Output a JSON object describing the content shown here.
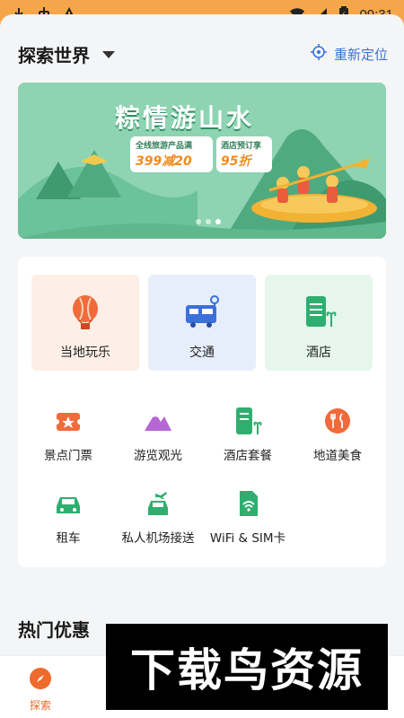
{
  "status_bar": {
    "time": "09:31",
    "icons": [
      "download-icon",
      "usb-icon",
      "warning-icon",
      "wifi-icon",
      "signal-icon",
      "battery-icon"
    ]
  },
  "header": {
    "location": "探索世界",
    "relocate_label": "重新定位"
  },
  "banner": {
    "title": "粽情游山水",
    "promo1_label": "全线旅游产品满",
    "promo1_value": "399减20",
    "promo2_label": "酒店预订享",
    "promo2_value": "95折",
    "dots": 3,
    "active_dot": 2
  },
  "categories": {
    "main": [
      {
        "label": "当地玩乐",
        "icon": "hot-air-balloon-icon"
      },
      {
        "label": "交通",
        "icon": "bus-icon"
      },
      {
        "label": "酒店",
        "icon": "hotel-icon"
      }
    ],
    "row1": [
      {
        "label": "景点门票",
        "icon": "ticket-icon"
      },
      {
        "label": "游览观光",
        "icon": "mountain-icon"
      },
      {
        "label": "酒店套餐",
        "icon": "hotel-package-icon"
      },
      {
        "label": "地道美食",
        "icon": "food-icon"
      }
    ],
    "row2": [
      {
        "label": "租车",
        "icon": "car-icon"
      },
      {
        "label": "私人机场接送",
        "icon": "airport-transfer-icon"
      },
      {
        "label": "WiFi & SIM卡",
        "icon": "sim-card-icon"
      }
    ]
  },
  "section": {
    "hot_deals": "热门优惠"
  },
  "bottom_nav": {
    "explore_label": "探索"
  },
  "watermark": {
    "text": "下载鸟资源"
  },
  "colors": {
    "status_bar": "#f6a64a",
    "accent_blue": "#3a73d9",
    "accent_orange": "#ef6a2d",
    "banner_green": "#8dd3b0"
  }
}
